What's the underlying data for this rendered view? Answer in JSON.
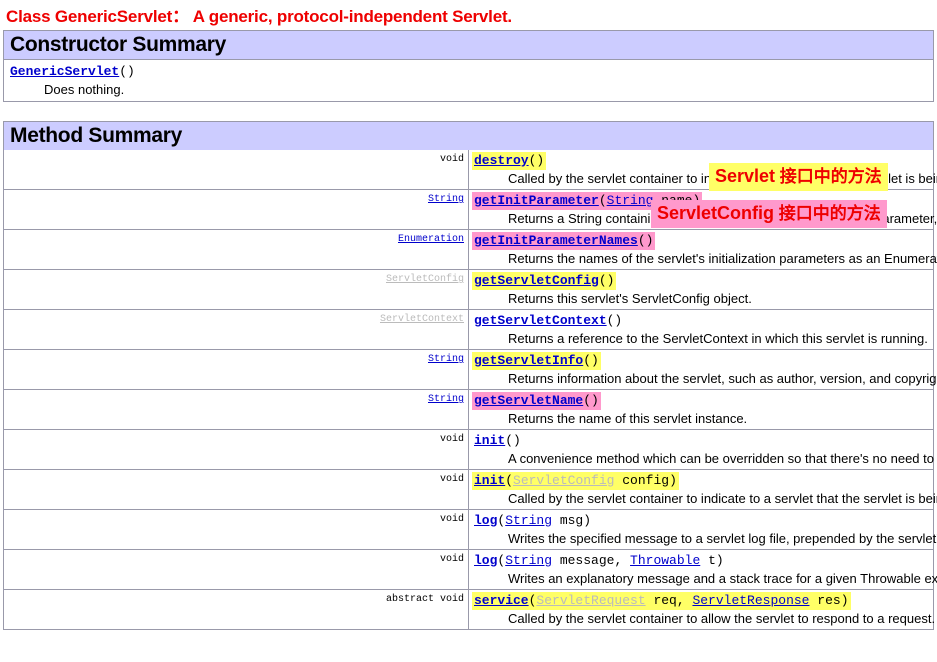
{
  "page": {
    "title": "Class GenericServlet：  A generic, protocol-independent Servlet.",
    "title_color": "#ee0000"
  },
  "colors": {
    "banner_bg": "#ccccff",
    "highlight_yellow": "#ffff66",
    "highlight_pink": "#ff99cc",
    "link": "#0000cc",
    "faded_link": "#bbbbbb",
    "border": "#9999aa"
  },
  "constructor_summary": {
    "heading": "Constructor Summary",
    "entries": [
      {
        "name": "GenericServlet",
        "args": "()",
        "description": "Does nothing."
      }
    ]
  },
  "method_summary": {
    "heading": "Method Summary",
    "rows": [
      {
        "type": "void",
        "type_style": "plain",
        "highlight": "yellow",
        "name": "destroy",
        "sig_tail": "()",
        "description": "Called by the servlet container to indicate to a servlet that the servlet is being taken out of service."
      },
      {
        "type": "String",
        "type_style": "link",
        "highlight": "pink",
        "name": "getInitParameter",
        "sig_open": "(",
        "sig_param_link": "String",
        "sig_param_name": " name",
        "sig_close": ")",
        "description": "Returns a String containing the value of the named initialization parameter, or null if the parameter does not exist."
      },
      {
        "type": "Enumeration",
        "type_style": "link",
        "highlight": "pink",
        "name": "getInitParameterNames",
        "sig_tail": "()",
        "description": "Returns the names of the servlet's initialization parameters as an Enumeration of String objects, or an empty Enumeration if the servlet ha"
      },
      {
        "type": "ServletConfig",
        "type_style": "faded",
        "highlight": "yellow",
        "name": "getServletConfig",
        "sig_tail": "()",
        "description": "Returns this servlet's ServletConfig object."
      },
      {
        "type": "ServletContext",
        "type_style": "faded",
        "highlight": "none",
        "name": "getServletContext",
        "sig_tail": "()",
        "description": "Returns a reference to the ServletContext in which this servlet is running."
      },
      {
        "type": "String",
        "type_style": "link",
        "highlight": "yellow",
        "name": "getServletInfo",
        "sig_tail": "()",
        "description": "Returns information about the servlet, such as author, version, and copyright."
      },
      {
        "type": "String",
        "type_style": "link",
        "highlight": "pink",
        "name": "getServletName",
        "sig_tail": "()",
        "description": "Returns the name of this servlet instance."
      },
      {
        "type": "void",
        "type_style": "plain",
        "highlight": "none",
        "name": "init",
        "sig_tail": "()",
        "description": "A convenience method which can be overridden so that there's no need to call super.init(config)."
      },
      {
        "type": "void",
        "type_style": "plain",
        "highlight": "yellow",
        "name": "init",
        "sig_open": "(",
        "sig_param_link": "ServletConfig",
        "sig_param_name": " config",
        "sig_close": ")",
        "description": "Called by the servlet container to indicate to a servlet that the servlet is being placed into service."
      },
      {
        "type": "void",
        "type_style": "plain",
        "highlight": "none",
        "name": "log",
        "sig_open": "(",
        "sig_param_link": "String",
        "sig_param_name": " msg",
        "sig_close": ")",
        "description": "Writes the specified message to a servlet log file, prepended by the servlet's name."
      },
      {
        "type": "void",
        "type_style": "plain",
        "highlight": "none",
        "name": "log",
        "sig_open": "(",
        "sig_param_link": "String",
        "sig_param_name": " message,  ",
        "sig_param_link2": "Throwable",
        "sig_param_name2": " t",
        "sig_close": ")",
        "description": "Writes an explanatory message and a stack trace for a given Throwable exception to the servlet log file, prepended by the servlet's name."
      },
      {
        "type": "abstract  void",
        "type_style": "plain",
        "highlight": "yellow",
        "name": "service",
        "sig_open": "(",
        "sig_param_link": "ServletRequest",
        "sig_param_name": " req,  ",
        "sig_param_link2": "ServletResponse",
        "sig_param_name2": " res",
        "sig_close": ")",
        "description": "Called by the servlet container to allow the servlet to respond to a request."
      }
    ]
  },
  "annotations": [
    {
      "id": "servlet-interface-note",
      "bold_part": "Servlet",
      "cn_part": " 接口中的方法",
      "style": "yellow"
    },
    {
      "id": "servletconfig-interface-note",
      "bold_part": "ServletConfig",
      "cn_part": " 接口中的方法",
      "style": "pink"
    }
  ]
}
